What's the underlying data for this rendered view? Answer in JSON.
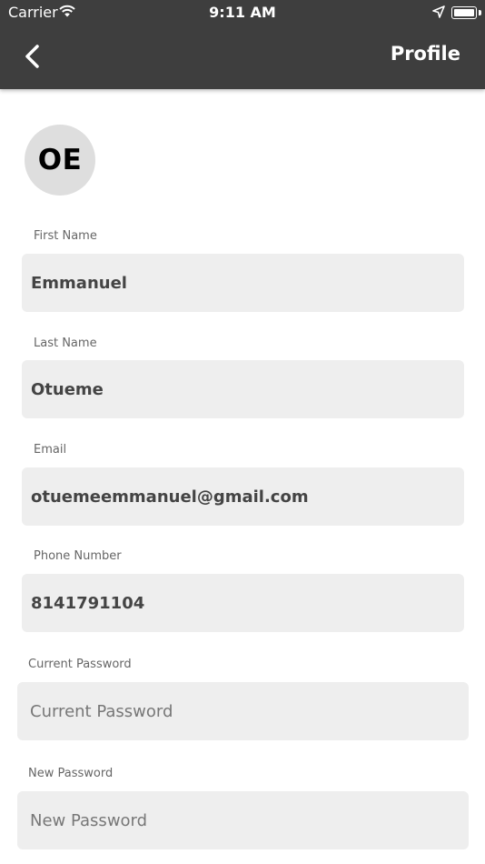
{
  "status_bar": {
    "carrier": "Carrier",
    "time": "9:11 AM"
  },
  "header": {
    "title": "Profile"
  },
  "avatar": {
    "initials": "OE"
  },
  "form": {
    "first_name": {
      "label": "First Name",
      "value": "Emmanuel"
    },
    "last_name": {
      "label": "Last Name",
      "value": "Otueme"
    },
    "email": {
      "label": "Email",
      "value": "otuemeemmanuel@gmail.com"
    },
    "phone": {
      "label": "Phone Number",
      "value": "8141791104"
    },
    "current_password": {
      "label": "Current Password",
      "placeholder": "Current Password",
      "value": ""
    },
    "new_password": {
      "label": "New Password",
      "placeholder": "New Password",
      "value": ""
    }
  },
  "colors": {
    "header_bg": "#3e3e3e",
    "field_bg": "#eeeeee",
    "avatar_bg": "#dedede"
  },
  "icons": [
    "chevron-left-icon",
    "wifi-icon",
    "location-arrow-icon",
    "battery-icon"
  ]
}
